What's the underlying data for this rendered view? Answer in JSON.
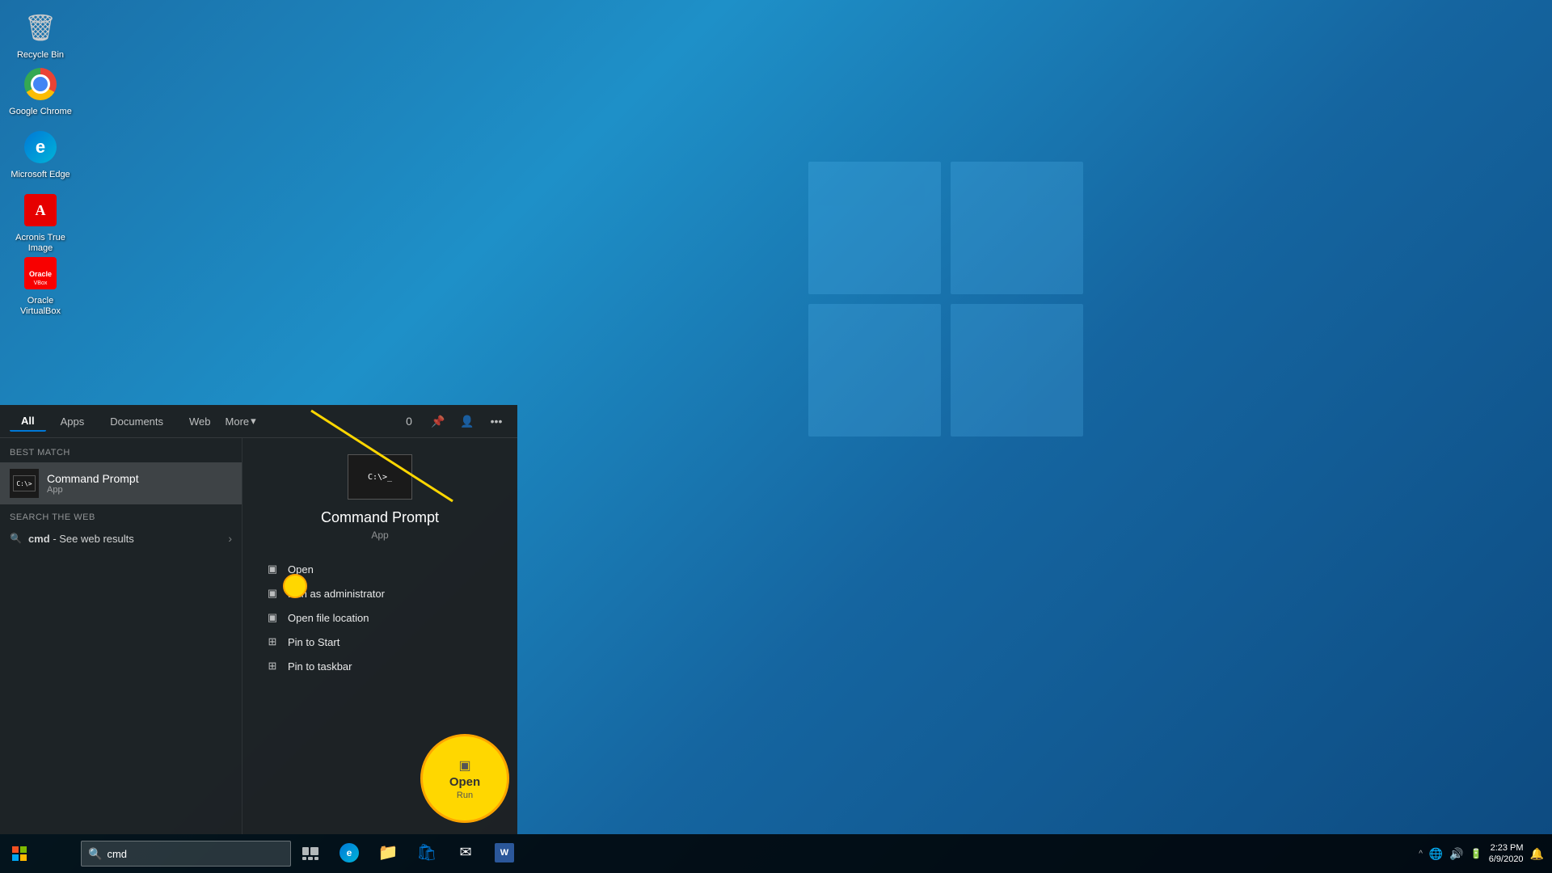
{
  "desktop": {
    "icons": [
      {
        "id": "recycle",
        "label": "Recycle Bin",
        "type": "recycle"
      },
      {
        "id": "chrome",
        "label": "Google Chrome",
        "type": "chrome"
      },
      {
        "id": "edge",
        "label": "Microsoft Edge",
        "type": "edge"
      },
      {
        "id": "acronis",
        "label": "Acronis True Image",
        "type": "acronis"
      },
      {
        "id": "oracle",
        "label": "Oracle VirtualBox",
        "type": "oracle"
      }
    ]
  },
  "taskbar": {
    "search_placeholder": "cmd",
    "search_value": "cmd",
    "clock_time": "2:23 PM",
    "clock_date": "6/9/2020",
    "apps": [
      "search",
      "task-view",
      "edge",
      "explorer",
      "store",
      "mail",
      "word"
    ]
  },
  "start_menu": {
    "tabs": [
      "All",
      "Apps",
      "Documents",
      "Web",
      "More"
    ],
    "best_match_label": "Best match",
    "best_match_item": {
      "name": "Command Prompt",
      "type": "App"
    },
    "search_web_label": "Search the web",
    "web_query": "cmd",
    "web_sub": "- See web results",
    "right_panel": {
      "app_name": "Command Prompt",
      "app_type": "App",
      "actions": [
        {
          "label": "Open",
          "icon": "▣"
        },
        {
          "label": "Run as administrator",
          "icon": "▣"
        },
        {
          "label": "Open file location",
          "icon": "▣"
        },
        {
          "label": "Pin to Start",
          "icon": "⊞"
        },
        {
          "label": "Pin to taskbar",
          "icon": "⊞"
        }
      ]
    }
  },
  "annotation": {
    "open_label": "Open",
    "run_label": "Run"
  }
}
